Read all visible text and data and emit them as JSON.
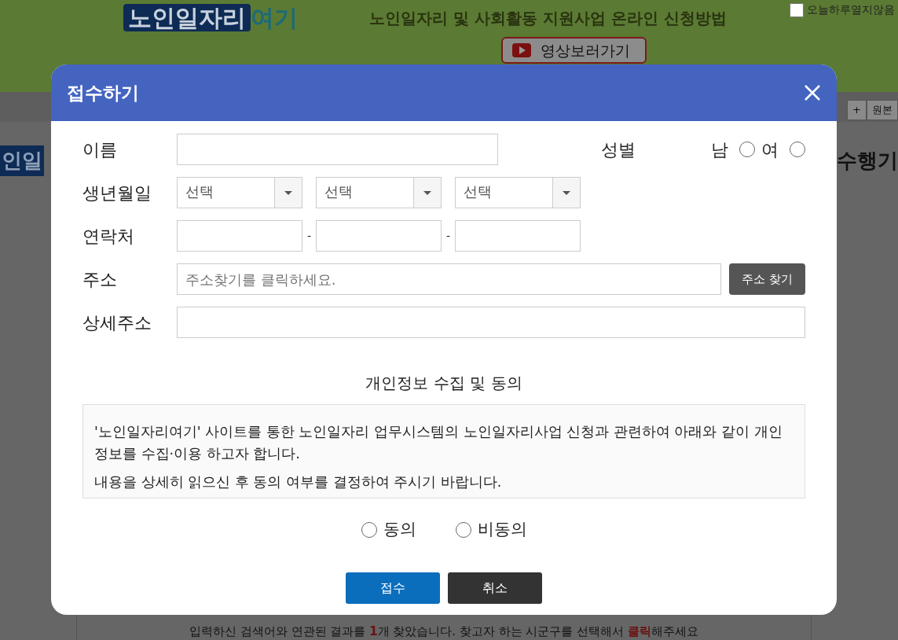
{
  "background": {
    "banner": {
      "logo_main": "노인일자리",
      "logo_accent": "여기",
      "headline": "노인일자리 및 사회활동 지원사업 온라인 신청방법",
      "hide_today": {
        "label": "오늘하루열지않음",
        "checked": false
      },
      "video_button": "영상보러가기"
    },
    "toolbar": [
      "+",
      "원본"
    ],
    "left_logo": "인일",
    "right_heading": "수행기",
    "result_message": "입력하신 검색어와 연관된 결과를 **1**개 찾았습니다. 찾고자 하는 시군구를 선택해서 **클릭**해주세요"
  },
  "dialog": {
    "title": "접수하기",
    "name_label": "이름",
    "gender_label": "성별",
    "gender_options": [
      {
        "label": "남",
        "selected": false
      },
      {
        "label": "여",
        "selected": false
      }
    ],
    "birth_label": "생년월일",
    "birth_selects": [
      "선택",
      "선택",
      "선택"
    ],
    "phone_label": "연락처",
    "phone_separators": [
      "-",
      "-"
    ],
    "address_label": "주소",
    "address": {
      "placeholder": "주소찾기를 클릭하세요."
    },
    "address_button": "주소 찾기",
    "detail_label": "상세주소",
    "consent_title": "개인정보 수집 및 동의",
    "consent_paragraphs": [
      "'노인일자리여기' 사이트를 통한 노인일자리 업무시스템의 노인일자리사업 신청과 관련하여 아래와 같이 개인정보를 수집·이용 하고자 합니다.",
      "내용을 상세히 읽으신 후 동의 여부를 결정하여 주시기 바랍니다."
    ],
    "consent_options": [
      {
        "label": "동의",
        "selected": false
      },
      {
        "label": "비동의",
        "selected": false
      }
    ],
    "buttons": [
      {
        "label": "접수",
        "kind": "primary"
      },
      {
        "label": "취소",
        "kind": "dark"
      }
    ]
  }
}
